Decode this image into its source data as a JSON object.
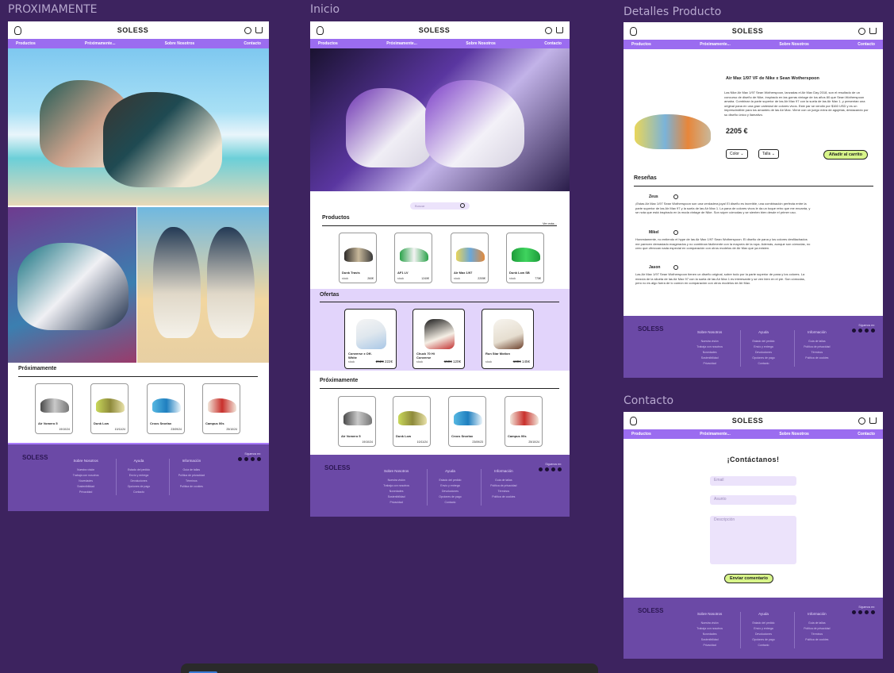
{
  "frames": {
    "proximamente": {
      "label": "PROXIMAMENTE"
    },
    "inicio": {
      "label": "Inicio"
    },
    "detalles": {
      "label": "Detalles Producto"
    },
    "contacto": {
      "label": "Contacto"
    }
  },
  "header": {
    "brand": "SOLESS"
  },
  "nav": [
    "Productos",
    "Próximamente...",
    "Sobre Nosotros",
    "Contacto"
  ],
  "footer": {
    "brand": "SOLESS",
    "social_label": "Síguenos en:",
    "cols": [
      {
        "title": "Sobre Nosotros",
        "items": [
          "Nuestra visión",
          "Trabaja con nosotros",
          "Novedades",
          "Sostenibilidad",
          "Privacidad"
        ]
      },
      {
        "title": "Ayuda",
        "items": [
          "Estado del pedido",
          "Envío y entrega",
          "Devoluciones",
          "Opciones de pago",
          "Contacto"
        ]
      },
      {
        "title": "Información",
        "items": [
          "Guía de tallas",
          "Política de privacidad",
          "Términos",
          "Política de cookies"
        ]
      }
    ]
  },
  "proximamente": {
    "section_title": "Próximamente",
    "cards": [
      {
        "name": "Air Vomero 5",
        "date": "19/10/24"
      },
      {
        "name": "Dunk Low",
        "date": "10/11/24"
      },
      {
        "name": "Crocs Snorlax",
        "date": "23/09/24"
      },
      {
        "name": "Campus 00s",
        "date": "25/10/24"
      }
    ]
  },
  "inicio": {
    "search_placeholder": "Buscar",
    "products_title": "Productos",
    "see_more": "Ver más...",
    "products": [
      {
        "name": "Dunk Travis",
        "price": "260€",
        "stock": "stock"
      },
      {
        "name": "AF1 LV",
        "price": "1240€",
        "stock": "stock"
      },
      {
        "name": "Air Max 1/97",
        "price": "2205€",
        "stock": "stock"
      },
      {
        "name": "Dunk Low SB",
        "price": "775€",
        "stock": "stock"
      }
    ],
    "offers_title": "Ofertas",
    "offers": [
      {
        "name": "Converse x Off-White",
        "old": "262€",
        "price": "222€",
        "stock": "stock"
      },
      {
        "name": "Chuck 70 Hi Converse",
        "old": "150€",
        "price": "120€",
        "stock": "stock"
      },
      {
        "name": "Run Star Motion",
        "old": "180€",
        "price": "145€",
        "stock": "stock"
      }
    ],
    "coming_title": "Próximamente",
    "coming": [
      {
        "name": "Air Vomero 5",
        "date": "19/10/24"
      },
      {
        "name": "Dunk Low",
        "date": "10/11/24"
      },
      {
        "name": "Crocs Snorlax",
        "date": "23/09/23"
      },
      {
        "name": "Campus 00s",
        "date": "25/10/24"
      }
    ]
  },
  "detalles": {
    "title": "Air Max 1/97 VF de Nike x Sean Wotherspoon",
    "description": "Las Nike Air Max 1/97 Sean Wotherspoon, lanzadas el Air Max Day 2018, son el resultado de un concurso de diseño de Nike, inspirado en las gorras vintage de los años 80 que Sean Wotherspoon amaba. Combinan la parte superior de las Air Max 97 con la suela de las Air Max 1, y presentan una original pana en una gran variedad de colores vivos. Este par se vendió por $160 USD y es un imprescindible para los amantes de las Air Max. Viene con un juego extra de agujetas, destacando por su diseño único y llamativo.",
    "price": "2205 €",
    "color_label": "Color",
    "size_label": "Talla",
    "add_to_cart": "Añadir al carrito",
    "reviews_title": "Reseñas",
    "reviews": [
      {
        "name": "Zeus",
        "text": "¡Estas Air Max 1/97 Sean Wotherspoon son una verdadera joya! El diseño es increíble, una combinación perfecta entre la parte superior de las Air Max 97 y la suela de las Air Max 1. La pana de colores vivos le da un toque retro que me encanta, y se nota que está inspirado en la moda vintage de Nike. Son súper cómodas y se sienten bien desde el primer uso."
      },
      {
        "name": "Mikel",
        "text": "Honestamente, no entiendo el hype de las Air Max 1/97 Sean Wotherspoon. El diseño de pana y los colores desfilachados me parecen demasiado exagerados y no combinan fácilmente con la mayoría de la ropa. Además, aunque son cómodas, no creo que ofrezcan nada especial en comparación con otros modelos de Air Max que ya existen."
      },
      {
        "name": "Jason",
        "text": "Las Air Max 1/97 Sean Wotherspoon tienen un diseño original, sobre todo por la parte superior de pana y los colores. La mezcla de la silueta de las Air Max 97 con la suela de las Air Max 1 es interesante y se ven bien en el pie. Son cómodas, pero no es algo fuera de lo común en comparación con otros modelos de Air Max."
      }
    ]
  },
  "contacto": {
    "title": "¡Contáctanos!",
    "email_placeholder": "Email",
    "subject_placeholder": "Asunto",
    "description_placeholder": "Descripción",
    "submit": "Enviar comentario"
  },
  "colors": {
    "background": "#3d235f",
    "nav": "#9b6cf0",
    "footer": "#6b49a6",
    "offers_band": "#e2d4fb",
    "accent_button": "#d8f58a"
  }
}
